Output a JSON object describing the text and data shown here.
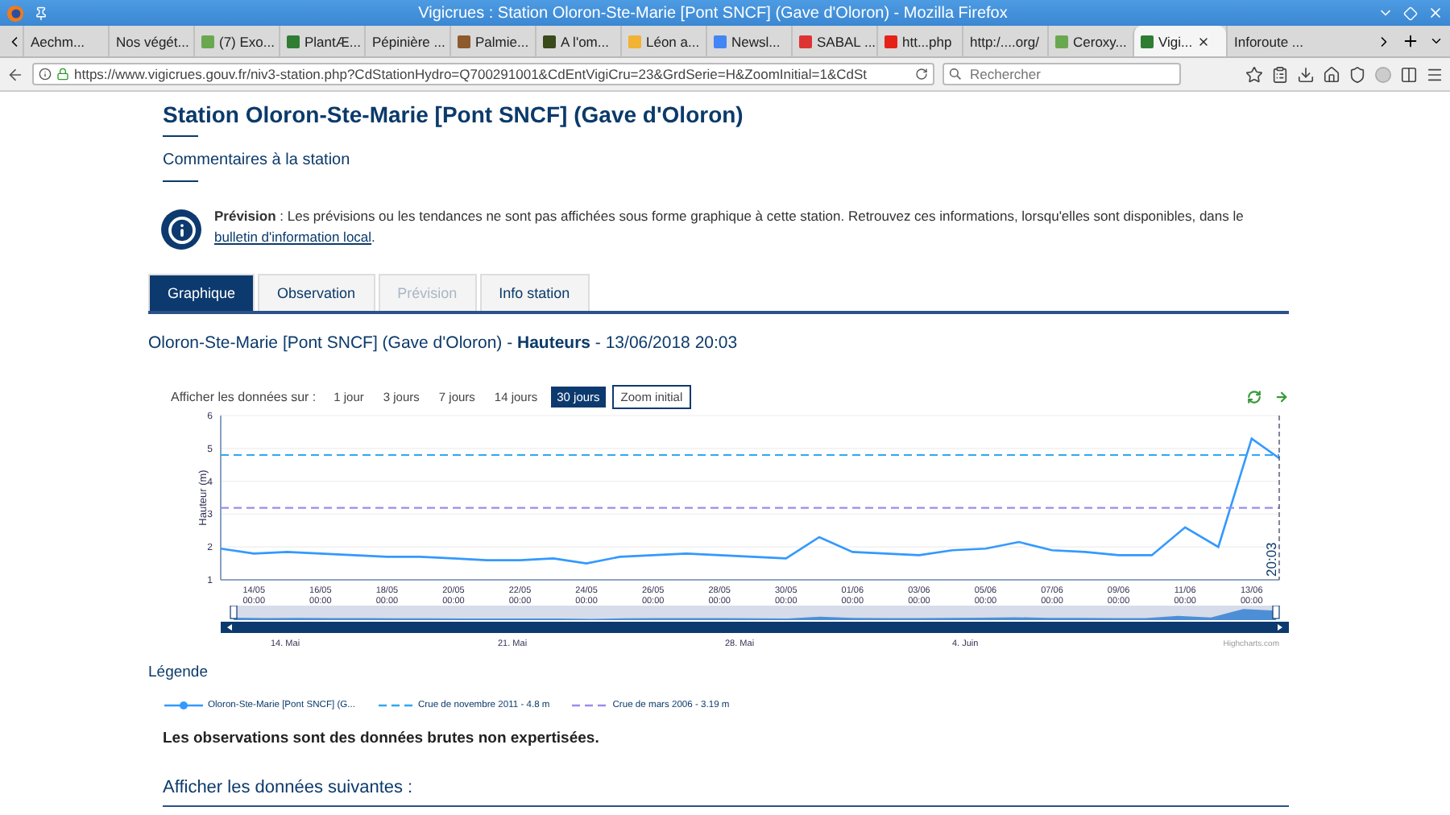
{
  "window": {
    "title": "Vigicrues : Station Oloron-Ste-Marie [Pont SNCF] (Gave d'Oloron) - Mozilla Firefox"
  },
  "browser_tabs": [
    {
      "label": "Aechm...",
      "kind": "plain",
      "selected": false
    },
    {
      "label": "Nos végét...",
      "kind": "plain",
      "selected": false
    },
    {
      "label": "(7) Exo...",
      "kind": "icon",
      "selected": false
    },
    {
      "label": "PlantÆ...",
      "kind": "icon",
      "selected": false
    },
    {
      "label": "Pépinière ...",
      "kind": "plain",
      "selected": false
    },
    {
      "label": "Palmie...",
      "kind": "icon",
      "selected": false
    },
    {
      "label": "A l'om...",
      "kind": "icon",
      "selected": false
    },
    {
      "label": "Léon a...",
      "kind": "icon",
      "selected": false
    },
    {
      "label": "Newsl...",
      "kind": "icon",
      "selected": false
    },
    {
      "label": "SABAL ...",
      "kind": "icon",
      "selected": false
    },
    {
      "label": "htt...php",
      "kind": "icon",
      "selected": false
    },
    {
      "label": "http:/....org/",
      "kind": "plain",
      "selected": false
    },
    {
      "label": "Ceroxy...",
      "kind": "icon",
      "selected": false
    },
    {
      "label": "Vigi...",
      "kind": "icon",
      "selected": true
    },
    {
      "label": "Inforoute ...",
      "kind": "plain",
      "selected": false
    }
  ],
  "address_bar": {
    "value": "https://www.vigicrues.gouv.fr/niv3-station.php?CdStationHydro=Q700291001&CdEntVigiCru=23&GrdSerie=H&ZoomInitial=1&CdSt"
  },
  "search": {
    "placeholder": "Rechercher"
  },
  "page": {
    "title": "Station Oloron-Ste-Marie [Pont SNCF] (Gave d'Oloron)",
    "comments_link": "Commentaires à la station",
    "notice": "**Prévision** : Les prévisions ou les tendances ne sont pas affichées sous forme graphique à cette station. Retrouvez ces informations, lorsqu'elles sont disponibles, dans le",
    "notice_link": "bulletin d'information local",
    "notice_end": "."
  },
  "tabs": [
    {
      "label": "Graphique",
      "selected": true,
      "disabled": false
    },
    {
      "label": "Observation",
      "selected": false,
      "disabled": false
    },
    {
      "label": "Prévision",
      "selected": false,
      "disabled": true
    },
    {
      "label": "Info station",
      "selected": false,
      "disabled": false
    }
  ],
  "chart_heading": "Oloron-Ste-Marie [Pont SNCF] (Gave d'Oloron) - **Hauteurs** - 13/06/2018 20:03",
  "range_selector": {
    "label": "Afficher les données sur :",
    "buttons": [
      {
        "label": "1 jour",
        "selected": false
      },
      {
        "label": "3 jours",
        "selected": false
      },
      {
        "label": "7 jours",
        "selected": false
      },
      {
        "label": "14 jours",
        "selected": false
      },
      {
        "label": "30 jours",
        "selected": true
      }
    ],
    "zoom_button": "Zoom initial"
  },
  "chart_data": {
    "type": "line",
    "ylabel": "Hauteur (m)",
    "ylim": [
      1,
      6
    ],
    "yticks": [
      1,
      2,
      3,
      4,
      5,
      6
    ],
    "grid": true,
    "categories": [
      null,
      "14/05 00:00",
      null,
      "16/05 00:00",
      null,
      "18/05 00:00",
      null,
      "20/05 00:00",
      null,
      "22/05 00:00",
      null,
      "24/05 00:00",
      null,
      "26/05 00:00",
      null,
      "28/05 00:00",
      null,
      "30/05 00:00",
      null,
      "01/06 00:00",
      null,
      "03/06 00:00",
      null,
      "05/06 00:00",
      null,
      "07/06 00:00",
      null,
      "09/06 00:00",
      null,
      "11/06 00:00",
      null,
      "13/06 00:00",
      null
    ],
    "series": [
      {
        "name": "Oloron-Ste-Marie [Pont SNCF] (G...",
        "color": "#3399ff",
        "line_style": "solid",
        "values": [
          1.95,
          1.8,
          1.85,
          1.8,
          1.75,
          1.7,
          1.7,
          1.65,
          1.6,
          1.6,
          1.65,
          1.5,
          1.7,
          1.75,
          1.8,
          1.75,
          1.7,
          1.65,
          2.3,
          1.85,
          1.8,
          1.75,
          1.9,
          1.95,
          2.15,
          1.9,
          1.85,
          1.75,
          1.75,
          2.6,
          2.0,
          5.3,
          4.7
        ]
      },
      {
        "name": "Crue de novembre 2011 - 4.8 m",
        "color": "#2fa8f0",
        "line_style": "dashed",
        "values": [
          4.8,
          4.8,
          4.8,
          4.8,
          4.8,
          4.8,
          4.8,
          4.8,
          4.8,
          4.8,
          4.8,
          4.8,
          4.8,
          4.8,
          4.8,
          4.8,
          4.8,
          4.8,
          4.8,
          4.8,
          4.8,
          4.8,
          4.8,
          4.8,
          4.8,
          4.8,
          4.8,
          4.8,
          4.8,
          4.8,
          4.8,
          4.8,
          4.8
        ]
      },
      {
        "name": "Crue de mars 2006 - 3.19 m",
        "color": "#9b8cf0",
        "line_style": "dashed",
        "values": [
          3.19,
          3.19,
          3.19,
          3.19,
          3.19,
          3.19,
          3.19,
          3.19,
          3.19,
          3.19,
          3.19,
          3.19,
          3.19,
          3.19,
          3.19,
          3.19,
          3.19,
          3.19,
          3.19,
          3.19,
          3.19,
          3.19,
          3.19,
          3.19,
          3.19,
          3.19,
          3.19,
          3.19,
          3.19,
          3.19,
          3.19,
          3.19,
          3.19
        ]
      }
    ],
    "annotations": [
      "20:03"
    ]
  },
  "navigator": {
    "labels": [
      "14. Mai",
      "21. Mai",
      "28. Mai",
      "4. Juin"
    ],
    "credit": "Highcharts.com"
  },
  "legend": {
    "title": "Légende"
  },
  "disclaimer": "Les observations sont des données brutes non expertisées.",
  "section_heading": "Afficher les données suivantes :"
}
